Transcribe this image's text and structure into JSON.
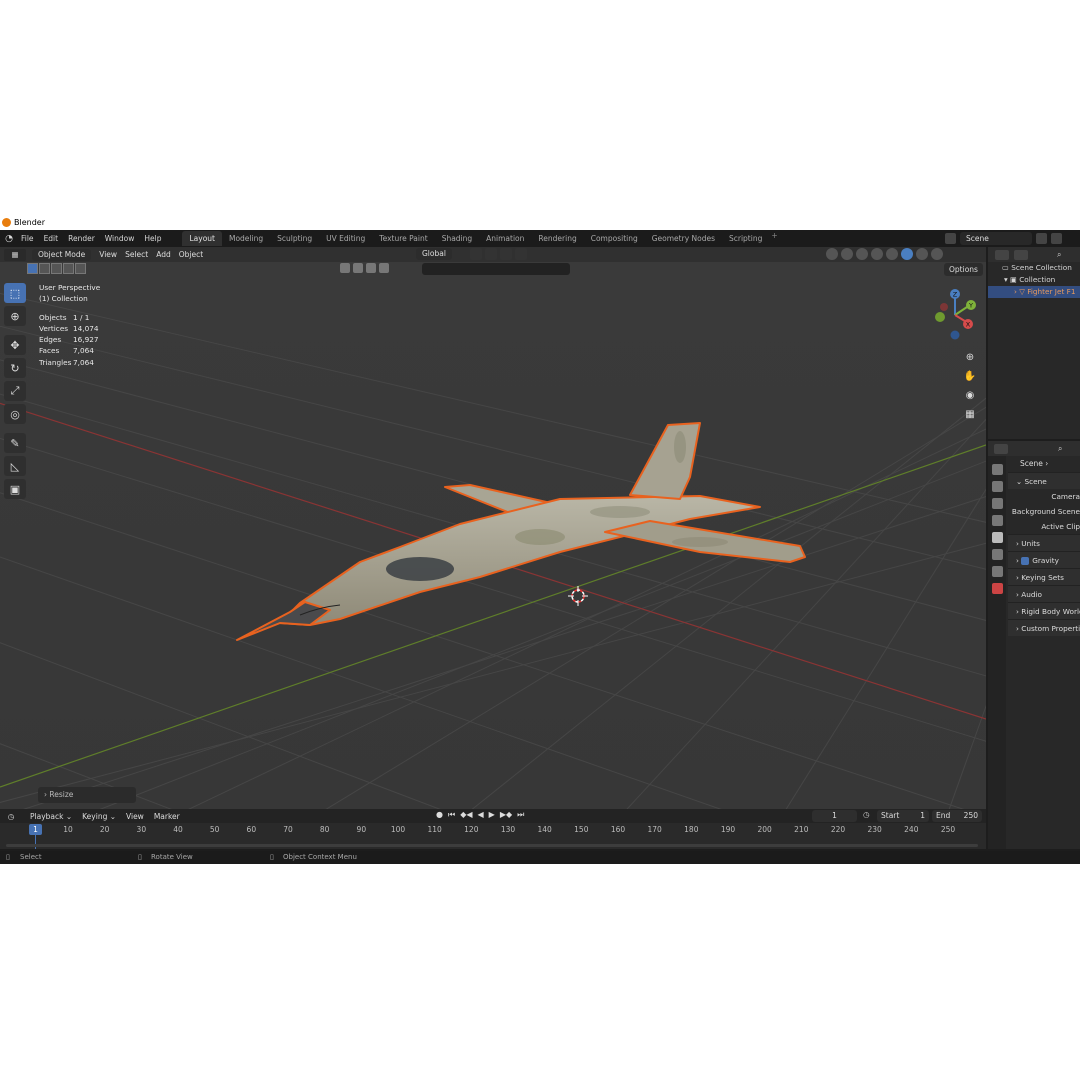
{
  "window": {
    "title": "Blender"
  },
  "menu": {
    "items": [
      "File",
      "Edit",
      "Render",
      "Window",
      "Help"
    ],
    "workspaces": [
      "Layout",
      "Modeling",
      "Sculpting",
      "UV Editing",
      "Texture Paint",
      "Shading",
      "Animation",
      "Rendering",
      "Compositing",
      "Geometry Nodes",
      "Scripting"
    ],
    "active_workspace": "Layout",
    "add_tab": "+",
    "scene": "Scene"
  },
  "viewport": {
    "mode": "Object Mode",
    "menus": [
      "View",
      "Select",
      "Add",
      "Object"
    ],
    "orientation": "Global",
    "options": "Options",
    "overlay": {
      "perspective": "User Perspective",
      "collection": "(1) Collection",
      "stats": [
        {
          "label": "Objects",
          "value": "1 / 1"
        },
        {
          "label": "Vertices",
          "value": "14,074"
        },
        {
          "label": "Edges",
          "value": "16,927"
        },
        {
          "label": "Faces",
          "value": "7,064"
        },
        {
          "label": "Triangles",
          "value": "7,064"
        }
      ]
    },
    "gizmo": {
      "z": "Z",
      "y": "Y",
      "x": "X"
    },
    "last_operator": "Resize"
  },
  "outliner": {
    "root": "Scene Collection",
    "collection": "Collection",
    "object": "Fighter Jet F1"
  },
  "properties": {
    "breadcrumb": "Scene",
    "panel": "Scene",
    "fields": [
      "Camera",
      "Background Scene",
      "Active Clip"
    ],
    "sections": [
      "Units",
      "Gravity",
      "Keying Sets",
      "Audio",
      "Rigid Body World",
      "Custom Properties"
    ],
    "gravity_checked": true
  },
  "timeline": {
    "menus": [
      "Playback",
      "Keying",
      "View",
      "Marker"
    ],
    "current_frame": "1",
    "start_label": "Start",
    "start": "1",
    "end_label": "End",
    "end": "250",
    "ticks": [
      "1",
      "10",
      "20",
      "30",
      "40",
      "50",
      "60",
      "70",
      "80",
      "90",
      "100",
      "110",
      "120",
      "130",
      "140",
      "150",
      "160",
      "170",
      "180",
      "190",
      "200",
      "210",
      "220",
      "230",
      "240",
      "250"
    ]
  },
  "statusbar": {
    "select": "Select",
    "rotate": "Rotate View",
    "context": "Object Context Menu"
  },
  "colors": {
    "accent": "#4772b3",
    "selection_outline": "#e8621f",
    "viewport_bg": "#393939",
    "x_axis": "#a23a3a",
    "y_axis": "#6b8d2e"
  }
}
